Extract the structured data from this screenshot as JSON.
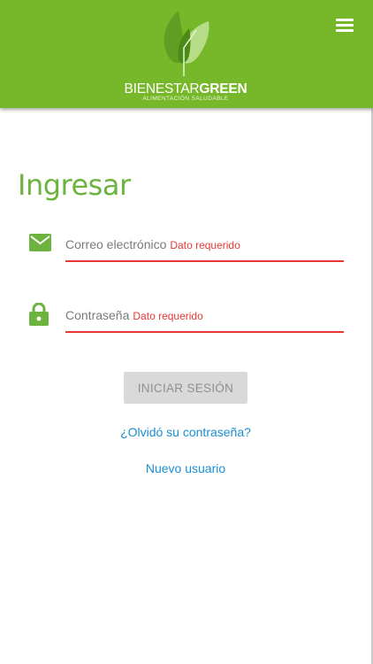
{
  "header": {
    "brand_light": "BIENESTAR",
    "brand_bold": "GREEN",
    "tagline": "ALIMENTACIÓN SALUDABLE",
    "colors": {
      "background": "#77b82a",
      "text": "#ffffff"
    }
  },
  "page": {
    "title": "Ingresar",
    "title_color": "#6db33f"
  },
  "form": {
    "email": {
      "placeholder": "Correo electrónico",
      "error": "Dato requerido",
      "icon": "envelope-icon"
    },
    "password": {
      "placeholder": "Contraseña",
      "error": "Dato requerido",
      "icon": "lock-icon"
    },
    "submit_label": "INICIAR SESIÓN",
    "error_color": "#e53935"
  },
  "links": {
    "forgot_password": "¿Olvidó su contraseña?",
    "new_user": "Nuevo usuario",
    "color": "#1a8fd1"
  }
}
